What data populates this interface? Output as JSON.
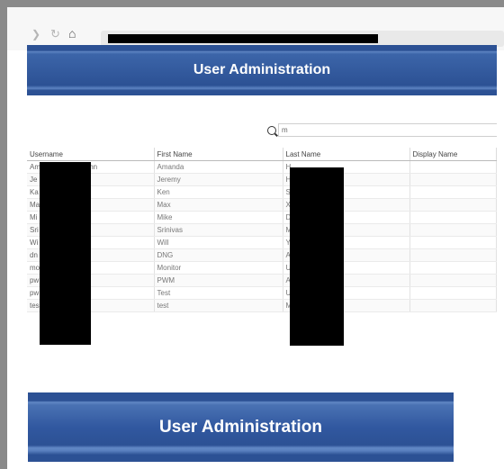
{
  "toolbar": {
    "back_icon": "chevron-left-icon",
    "reload_icon": "reload-icon",
    "home_icon": "home-icon"
  },
  "header": {
    "title": "User Administration"
  },
  "search": {
    "value": "m"
  },
  "table": {
    "columns": [
      "Username",
      "First Name",
      "Last Name",
      "Display Name"
    ],
    "rows": [
      {
        "username": "Am",
        "username_suffix": "Dehn",
        "first_name": "Amanda",
        "last_name": "H",
        "display_name": ""
      },
      {
        "username": "Je",
        "username_suffix": "",
        "first_name": "Jeremy",
        "last_name": "H",
        "display_name": ""
      },
      {
        "username": "Ka",
        "username_suffix": "",
        "first_name": "Ken",
        "last_name": "S",
        "display_name": ""
      },
      {
        "username": "Ma",
        "username_suffix": "",
        "first_name": "Max",
        "last_name": "X",
        "display_name": ""
      },
      {
        "username": "Mi",
        "username_suffix": "",
        "first_name": "Mike",
        "last_name": "D",
        "display_name": ""
      },
      {
        "username": "Sri",
        "username_suffix": "",
        "first_name": "Srinivas",
        "last_name": "M",
        "display_name": ""
      },
      {
        "username": "Wi",
        "username_suffix": "",
        "first_name": "Will",
        "last_name": "Y",
        "display_name": ""
      },
      {
        "username": "dn",
        "username_suffix": "",
        "first_name": "DNG",
        "last_name": "A",
        "display_name": ""
      },
      {
        "username": "mo",
        "username_suffix": "",
        "first_name": "Monitor",
        "last_name": "U",
        "display_name": ""
      },
      {
        "username": "pw",
        "username_suffix": "",
        "first_name": "PWM",
        "last_name": "A",
        "display_name": ""
      },
      {
        "username": "pw",
        "username_suffix": "",
        "first_name": "Test",
        "last_name": "U",
        "display_name": ""
      },
      {
        "username": "tes",
        "username_suffix": "",
        "first_name": "test",
        "last_name": "M",
        "display_name": ""
      }
    ]
  },
  "footer_banner": {
    "title": "User Administration"
  }
}
